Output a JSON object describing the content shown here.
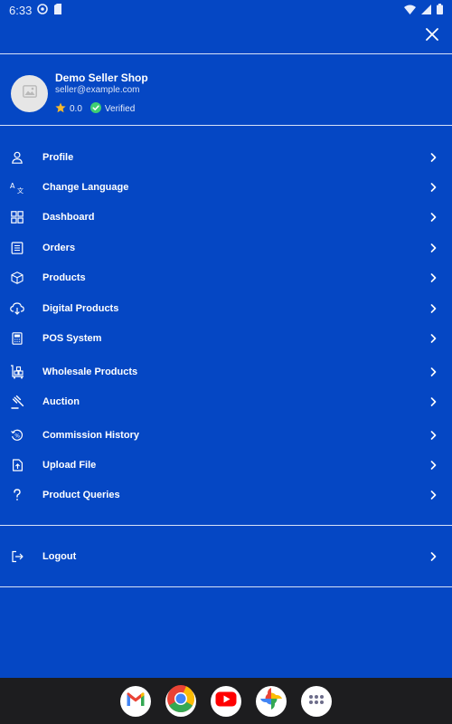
{
  "status_bar": {
    "time": "6:33",
    "icons": [
      "settings-status-icon",
      "storage-status-icon",
      "wifi-icon",
      "signal-icon",
      "battery-icon"
    ]
  },
  "header": {
    "close_icon": "close-icon"
  },
  "profile": {
    "shop_name": "Demo Seller Shop",
    "email": "seller@example.com",
    "rating": "0.0",
    "verified_label": "Verified",
    "rating_color": "#f5b82e",
    "verified_color": "#3fcf72"
  },
  "menu": {
    "items": [
      {
        "label": "Profile",
        "icon": "person-icon"
      },
      {
        "label": "Change Language",
        "icon": "translate-icon"
      },
      {
        "label": "Dashboard",
        "icon": "dashboard-icon"
      },
      {
        "label": "Orders",
        "icon": "orders-icon"
      },
      {
        "label": "Products",
        "icon": "box-icon"
      },
      {
        "label": "Digital Products",
        "icon": "cloud-download-icon"
      },
      {
        "label": "POS System",
        "icon": "pos-icon"
      },
      {
        "label": "Wholesale Products",
        "icon": "wholesale-icon"
      },
      {
        "label": "Auction",
        "icon": "gavel-icon"
      },
      {
        "label": "Commission History",
        "icon": "commission-icon"
      },
      {
        "label": "Upload File",
        "icon": "upload-file-icon"
      },
      {
        "label": "Product Queries",
        "icon": "question-icon"
      }
    ],
    "logout_label": "Logout"
  },
  "dock": {
    "apps": [
      "gmail-icon",
      "chrome-icon",
      "youtube-icon",
      "photos-icon",
      "app-drawer-icon"
    ]
  },
  "colors": {
    "background": "#0547c4",
    "divider": "#d9e3f8",
    "dock": "#1d1d1f"
  }
}
